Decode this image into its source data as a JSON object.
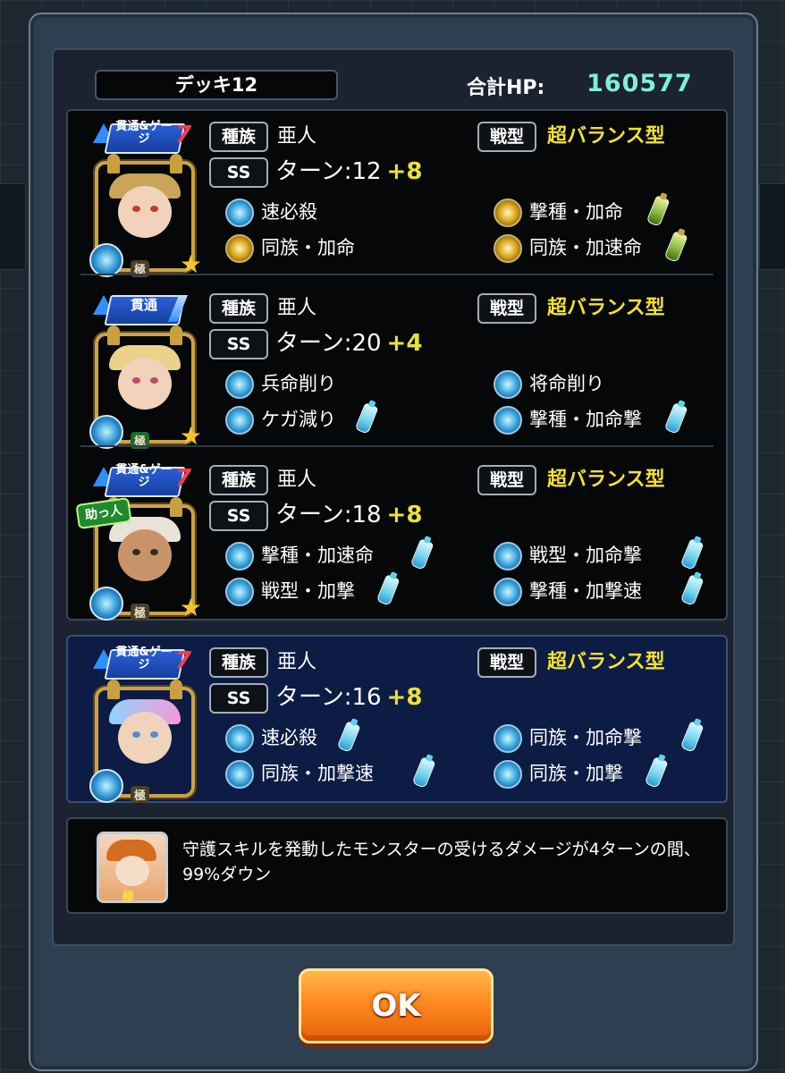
{
  "deck": {
    "name": "デッキ12",
    "hp_label": "合計HP:",
    "hp_value": "160577"
  },
  "labels": {
    "race": "種族",
    "type": "戦型",
    "ss": "SS",
    "helper": "助っ人"
  },
  "monsters": [
    {
      "badge": "貫通&ゲージ",
      "badge_number": "7",
      "race": "亜人",
      "type": "超バランス型",
      "turn": "ターン:12",
      "turn_plus": "+8",
      "abilities": [
        "速必殺",
        "撃種・加命",
        "同族・加命",
        "同族・加速命"
      ]
    },
    {
      "badge": "貫通",
      "badge_number": "",
      "race": "亜人",
      "type": "超バランス型",
      "turn": "ターン:20",
      "turn_plus": "+4",
      "abilities": [
        "兵命削り",
        "将命削り",
        "ケガ減り",
        "撃種・加命撃"
      ]
    },
    {
      "badge": "貫通&ゲージ",
      "badge_number": "7",
      "race": "亜人",
      "type": "超バランス型",
      "turn": "ターン:18",
      "turn_plus": "+8",
      "abilities": [
        "撃種・加速命",
        "戦型・加命撃",
        "戦型・加撃",
        "撃種・加撃速"
      ]
    },
    {
      "badge": "貫通&ゲージ",
      "badge_number": "7",
      "race": "亜人",
      "type": "超バランス型",
      "turn": "ターン:16",
      "turn_plus": "+8",
      "abilities": [
        "速必殺",
        "同族・加命撃",
        "同族・加撃速",
        "同族・加撃"
      ]
    }
  ],
  "skill": {
    "text": "守護スキルを発動したモンスターの受けるダメージが4ターンの間、99%ダウン",
    "portrait_mark": "極"
  },
  "ok_button": {
    "label": "OK"
  },
  "colors": {
    "hp": "#7ef0d6",
    "type": "#f3e22c",
    "turn_plus": "#e8e23a",
    "friend_panel": "#0d1c44"
  }
}
